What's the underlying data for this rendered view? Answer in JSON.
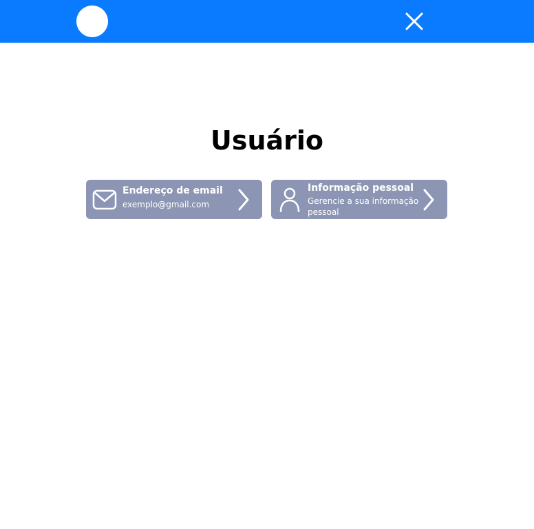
{
  "header": {
    "brand_color": "#0a7bff",
    "avatar_icon": "avatar-circle",
    "close_icon": "close-icon"
  },
  "page": {
    "title": "Usuário"
  },
  "cards": {
    "email": {
      "icon": "mail-icon",
      "label": "Endereço de email",
      "value": "exemplo@gmail.com"
    },
    "personal": {
      "icon": "user-icon",
      "label": "Informação pessoal",
      "description": "Gerencie a sua informação pessoal"
    },
    "card_color": "#8c96b4"
  }
}
